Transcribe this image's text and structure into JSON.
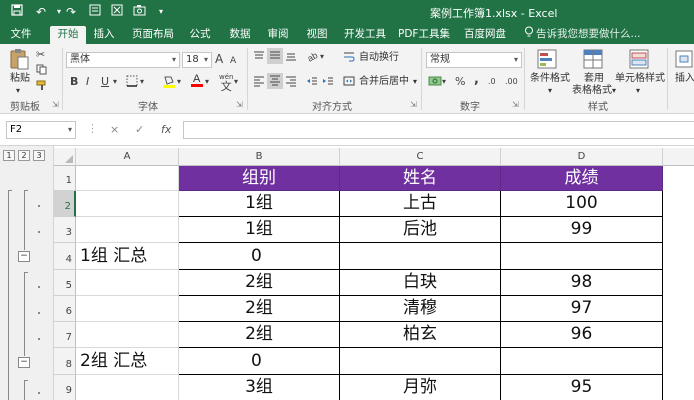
{
  "window": {
    "title": "案例工作簿1.xlsx - Excel"
  },
  "tabs": [
    {
      "label": "文件"
    },
    {
      "label": "开始"
    },
    {
      "label": "插入"
    },
    {
      "label": "页面布局"
    },
    {
      "label": "公式"
    },
    {
      "label": "数据"
    },
    {
      "label": "审阅"
    },
    {
      "label": "视图"
    },
    {
      "label": "开发工具"
    },
    {
      "label": "PDF工具集"
    },
    {
      "label": "百度网盘"
    }
  ],
  "tell_me": "告诉我您想要做什么...",
  "ribbon": {
    "paste_label": "粘贴",
    "clipboard_group": "剪贴板",
    "font_name": "黑体",
    "font_size": "18",
    "bold": "B",
    "italic": "I",
    "underline": "U",
    "increase_font": "A",
    "decrease_font": "A",
    "wen_label": "wén",
    "font_group": "字体",
    "wrap_text": "自动换行",
    "merge_center": "合并后居中",
    "alignment_group": "对齐方式",
    "number_format": "常规",
    "percent": "%",
    "comma": ",",
    "dec_inc": ".0",
    "dec_dec": ".00",
    "number_group": "数字",
    "conditional_format": "条件格式",
    "table_format_line1": "套用",
    "table_format_line2": "表格格式",
    "cell_styles": "单元格样式",
    "styles_group": "样式",
    "insert_label": "插入"
  },
  "formula_bar": {
    "name_box": "F2",
    "cancel": "×",
    "enter": "✓",
    "fx": "fx",
    "formula": ""
  },
  "outline_levels": [
    "1",
    "2",
    "3"
  ],
  "columns": [
    "A",
    "B",
    "C",
    "D"
  ],
  "rows": [
    "1",
    "2",
    "3",
    "4",
    "5",
    "6",
    "7",
    "8",
    "9"
  ],
  "cells": {
    "B1": "组别",
    "C1": "姓名",
    "D1": "成绩",
    "B2": "1组",
    "C2": "上古",
    "D2": "100",
    "B3": "1组",
    "C3": "后池",
    "D3": "99",
    "A4": "1组 汇总",
    "B4": "0",
    "B5": "2组",
    "C5": "白玦",
    "D5": "98",
    "B6": "2组",
    "C6": "清穆",
    "D6": "97",
    "B7": "2组",
    "C7": "柏玄",
    "D7": "96",
    "A8": "2组 汇总",
    "B8": "0",
    "B9": "3组",
    "C9": "月弥",
    "D9": "95"
  },
  "colors": {
    "excel_green": "#217346",
    "header_purple": "#7030a0"
  }
}
